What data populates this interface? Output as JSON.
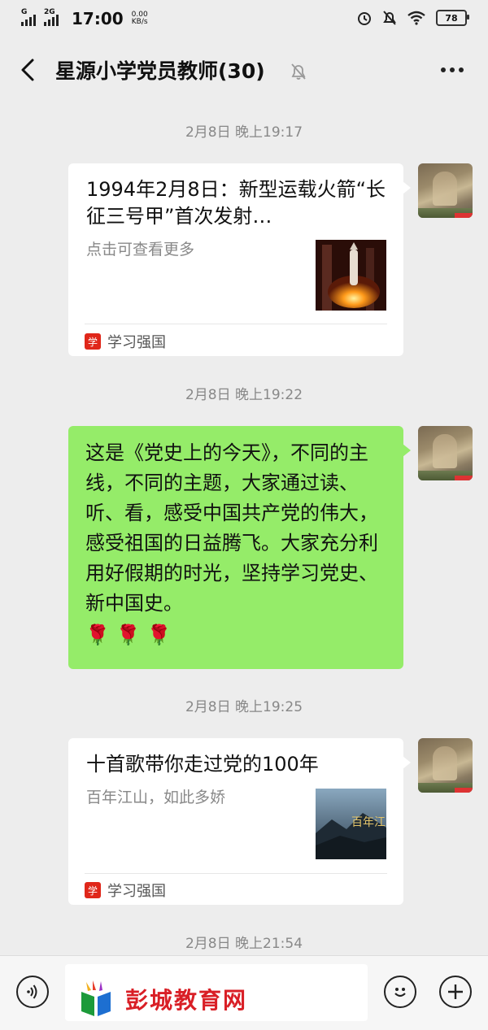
{
  "status_bar": {
    "signal1_label": "G",
    "signal2_label": "2G",
    "time": "17:00",
    "speed_value": "0.00",
    "speed_unit": "KB/s",
    "battery": "78"
  },
  "header": {
    "title": "星源小学党员教师(30)",
    "back_icon": "back-chevron-icon",
    "mute_icon": "bell-mute-icon",
    "more_icon": "more-dots-icon"
  },
  "messages": [
    {
      "type": "timestamp",
      "text": "2月8日 晚上19:17"
    },
    {
      "type": "card",
      "title": "1994年2月8日：新型运载火箭“长征三号甲”首次发射…",
      "desc": "点击可查看更多",
      "source": "学习强国"
    },
    {
      "type": "timestamp",
      "text": "2月8日 晚上19:22"
    },
    {
      "type": "text",
      "text": "这是《党史上的今天》，不同的主线，不同的主题，大家通过读、听、看，感受中国共产党的伟大，感受祖国的日益腾飞。大家充分利用好假期的时光，坚持学习党史、新中国史。",
      "emoji": "🌹🌹🌹"
    },
    {
      "type": "timestamp",
      "text": "2月8日 晚上19:25"
    },
    {
      "type": "card",
      "title": "十首歌带你走过党的100年",
      "desc": "百年江山，如此多娇",
      "thumb_text": "百年江山",
      "source": "学习强国"
    },
    {
      "type": "timestamp",
      "text": "2月8日 晚上21:54"
    }
  ],
  "bottom_bar": {
    "voice_icon": "voice-icon",
    "emoji_icon": "emoji-icon",
    "plus_icon": "plus-icon",
    "watermark": "彭城教育网"
  },
  "colors": {
    "background": "#ededed",
    "my_bubble": "#95ec69",
    "source_red": "#e0271a",
    "watermark_red": "#d91f26"
  }
}
